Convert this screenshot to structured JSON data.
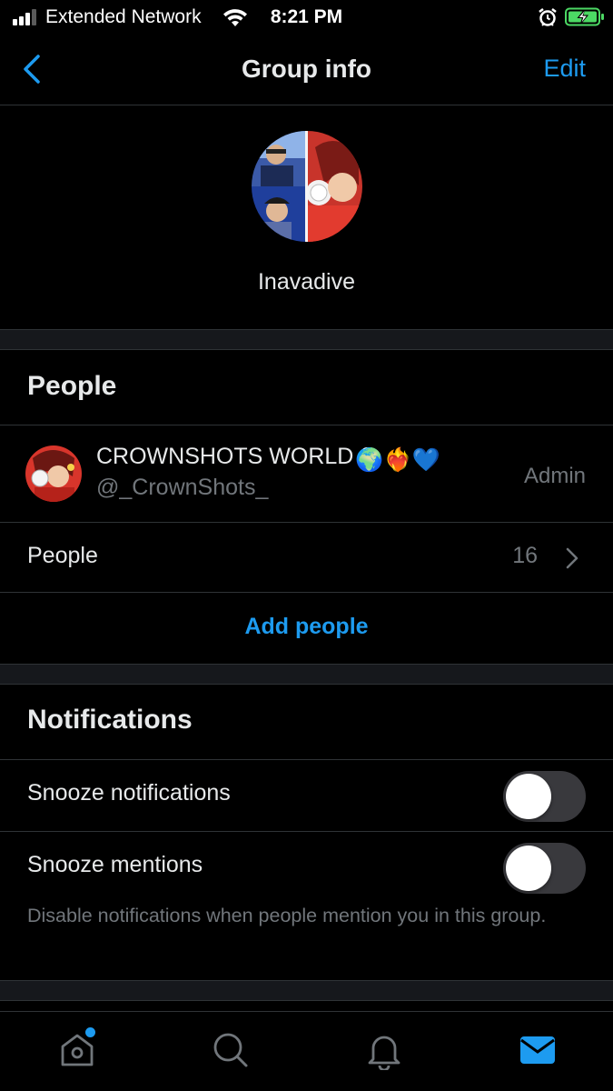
{
  "status_bar": {
    "carrier": "Extended Network",
    "time": "8:21 PM",
    "icons": [
      "signal-icon",
      "wifi-icon",
      "alarm-icon",
      "battery-charging-icon"
    ]
  },
  "nav": {
    "title": "Group info",
    "edit_label": "Edit",
    "back_icon": "chevron-left-icon"
  },
  "group": {
    "name": "Inavadive"
  },
  "people_section": {
    "title": "People",
    "members": [
      {
        "display_name": "CROWNSHOTS WORLD",
        "emojis": "🌍❤️‍🔥💙",
        "handle": "@_CrownShots_",
        "role": "Admin"
      }
    ],
    "people_label": "People",
    "people_count": "16",
    "add_people_label": "Add people"
  },
  "notifications_section": {
    "title": "Notifications",
    "snooze_notifications_label": "Snooze notifications",
    "snooze_notifications_on": false,
    "snooze_mentions_label": "Snooze mentions",
    "snooze_mentions_on": false,
    "helper_text": "Disable notifications when people mention you in this group."
  },
  "tab_bar": {
    "tabs": [
      "home-icon",
      "search-icon",
      "notifications-bell-icon",
      "messages-mail-icon"
    ],
    "active": "messages-mail-icon",
    "home_has_badge": true
  },
  "colors": {
    "background": "#000000",
    "accent": "#1d9bf0",
    "separator": "#16181c",
    "secondary_text": "#71767b",
    "toggle_off": "#39393d"
  }
}
